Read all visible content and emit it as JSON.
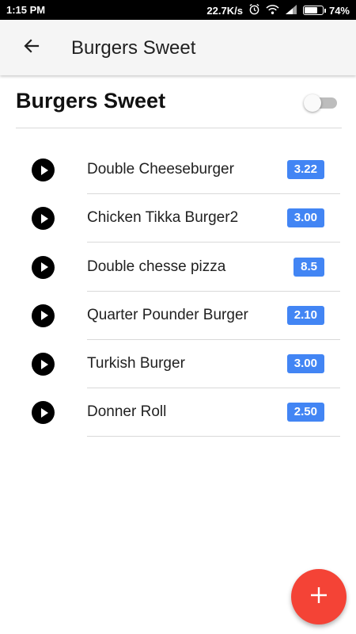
{
  "status_bar": {
    "time": "1:15 PM",
    "network_speed": "22.7K/s",
    "battery_percent": "74%",
    "battery_level": 0.74,
    "icons": [
      "alarm-icon",
      "wifi-icon",
      "signal-icon",
      "battery-icon"
    ]
  },
  "toolbar": {
    "back_icon": "arrow-left-icon",
    "title": "Burgers Sweet"
  },
  "header": {
    "title": "Burgers Sweet",
    "toggle_on": false
  },
  "items": [
    {
      "name": "Double Cheeseburger",
      "price": "3.22"
    },
    {
      "name": "Chicken Tikka Burger2",
      "price": "3.00"
    },
    {
      "name": "Double chesse pizza",
      "price": "8.5"
    },
    {
      "name": "Quarter Pounder Burger",
      "price": "2.10"
    },
    {
      "name": "Turkish Burger",
      "price": "3.00"
    },
    {
      "name": "Donner Roll",
      "price": "2.50"
    }
  ],
  "fab": {
    "icon": "plus-icon"
  },
  "colors": {
    "accent": "#4285f4",
    "fab": "#f44336",
    "toolbar_bg": "#f5f5f5",
    "status_bar_bg": "#000000"
  }
}
